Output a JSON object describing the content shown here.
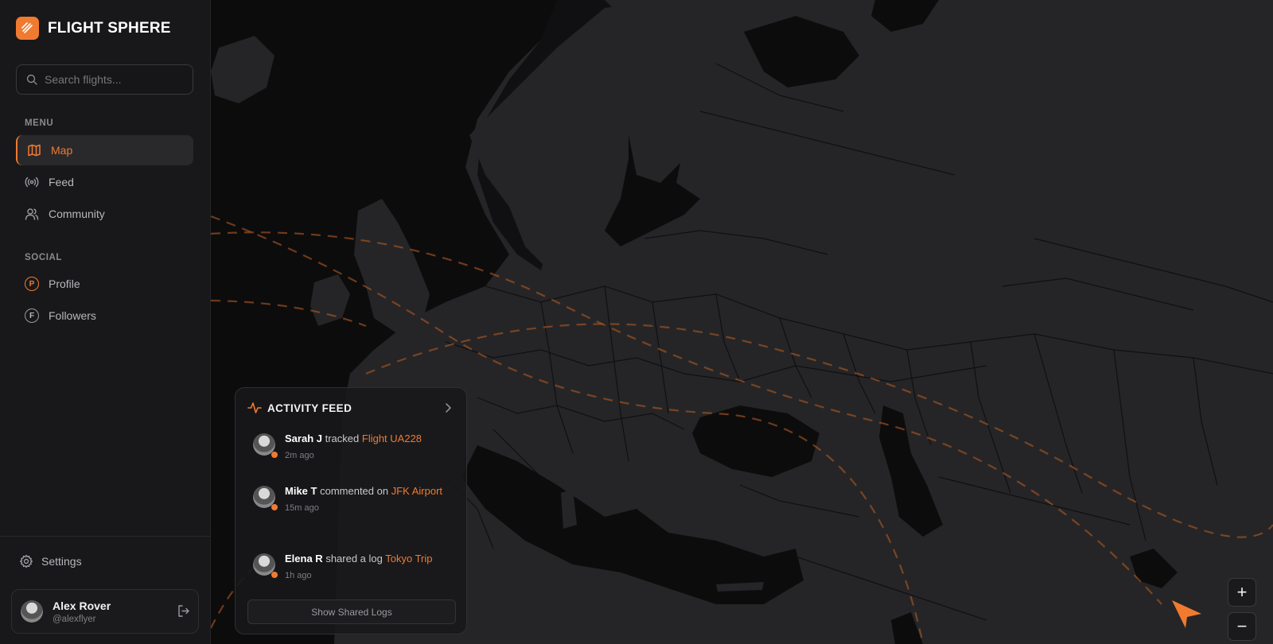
{
  "app": {
    "name": "FLIGHT SPHERE"
  },
  "search": {
    "placeholder": "Search flights..."
  },
  "menu": {
    "label": "MENU",
    "items": [
      {
        "label": "Map",
        "icon": "map-icon",
        "active": true
      },
      {
        "label": "Feed",
        "icon": "broadcast-icon"
      },
      {
        "label": "Community",
        "icon": "users-icon"
      }
    ]
  },
  "social": {
    "label": "SOCIAL",
    "items": [
      {
        "label": "Profile",
        "icon": "profile-letter-icon",
        "letter": "P"
      },
      {
        "label": "Followers",
        "icon": "followers-letter-icon",
        "letter": "F"
      }
    ]
  },
  "settings": {
    "label": "Settings"
  },
  "user": {
    "name": "Alex Rover",
    "handle": "@alexflyer"
  },
  "activity": {
    "title": "ACTIVITY FEED",
    "items": [
      {
        "user": "Sarah J",
        "action": "tracked",
        "target": "Flight UA228",
        "time": "2m ago"
      },
      {
        "user": "Mike T",
        "action": "commented on",
        "target": "JFK Airport",
        "time": "15m ago"
      },
      {
        "user": "Elena R",
        "action": "shared a log",
        "target": "Tokyo Trip",
        "time": "1h ago"
      }
    ],
    "button": "Show Shared Logs"
  },
  "zoom": {
    "in": "+",
    "out": "−"
  },
  "colors": {
    "accent": "#f07a30",
    "sidebar": "#18181a",
    "map_land": "#252527",
    "map_sea": "#0c0c0d"
  }
}
